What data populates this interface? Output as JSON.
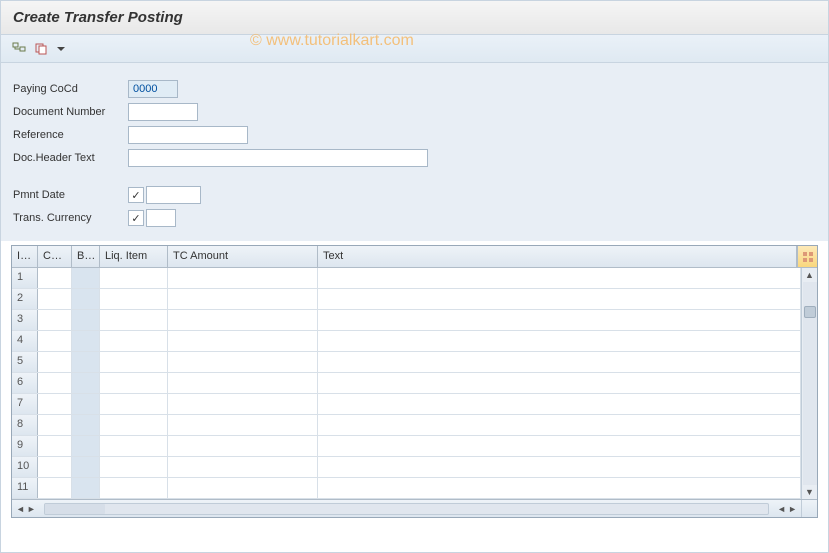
{
  "title": "Create Transfer Posting",
  "watermark": "© www.tutorialkart.com",
  "fields": {
    "paying_cocd": {
      "label": "Paying CoCd",
      "value": "0000"
    },
    "document_number": {
      "label": "Document Number",
      "value": ""
    },
    "reference": {
      "label": "Reference",
      "value": ""
    },
    "doc_header_text": {
      "label": "Doc.Header Text",
      "value": ""
    },
    "pmnt_date": {
      "label": "Pmnt Date",
      "checked": true,
      "value": ""
    },
    "trans_currency": {
      "label": "Trans. Currency",
      "checked": true,
      "value": ""
    }
  },
  "grid": {
    "columns": {
      "itm": "Itm",
      "cocd": "CoCd",
      "bu": "Bu...",
      "liq": "Liq. Item",
      "tc": "TC Amount",
      "text": "Text"
    },
    "rows": [
      {
        "itm": "1",
        "cocd": "",
        "bu": "",
        "liq": "",
        "tc": "",
        "text": ""
      },
      {
        "itm": "2",
        "cocd": "",
        "bu": "",
        "liq": "",
        "tc": "",
        "text": ""
      },
      {
        "itm": "3",
        "cocd": "",
        "bu": "",
        "liq": "",
        "tc": "",
        "text": ""
      },
      {
        "itm": "4",
        "cocd": "",
        "bu": "",
        "liq": "",
        "tc": "",
        "text": ""
      },
      {
        "itm": "5",
        "cocd": "",
        "bu": "",
        "liq": "",
        "tc": "",
        "text": ""
      },
      {
        "itm": "6",
        "cocd": "",
        "bu": "",
        "liq": "",
        "tc": "",
        "text": ""
      },
      {
        "itm": "7",
        "cocd": "",
        "bu": "",
        "liq": "",
        "tc": "",
        "text": ""
      },
      {
        "itm": "8",
        "cocd": "",
        "bu": "",
        "liq": "",
        "tc": "",
        "text": ""
      },
      {
        "itm": "9",
        "cocd": "",
        "bu": "",
        "liq": "",
        "tc": "",
        "text": ""
      },
      {
        "itm": "10",
        "cocd": "",
        "bu": "",
        "liq": "",
        "tc": "",
        "text": ""
      },
      {
        "itm": "11",
        "cocd": "",
        "bu": "",
        "liq": "",
        "tc": "",
        "text": ""
      }
    ]
  }
}
